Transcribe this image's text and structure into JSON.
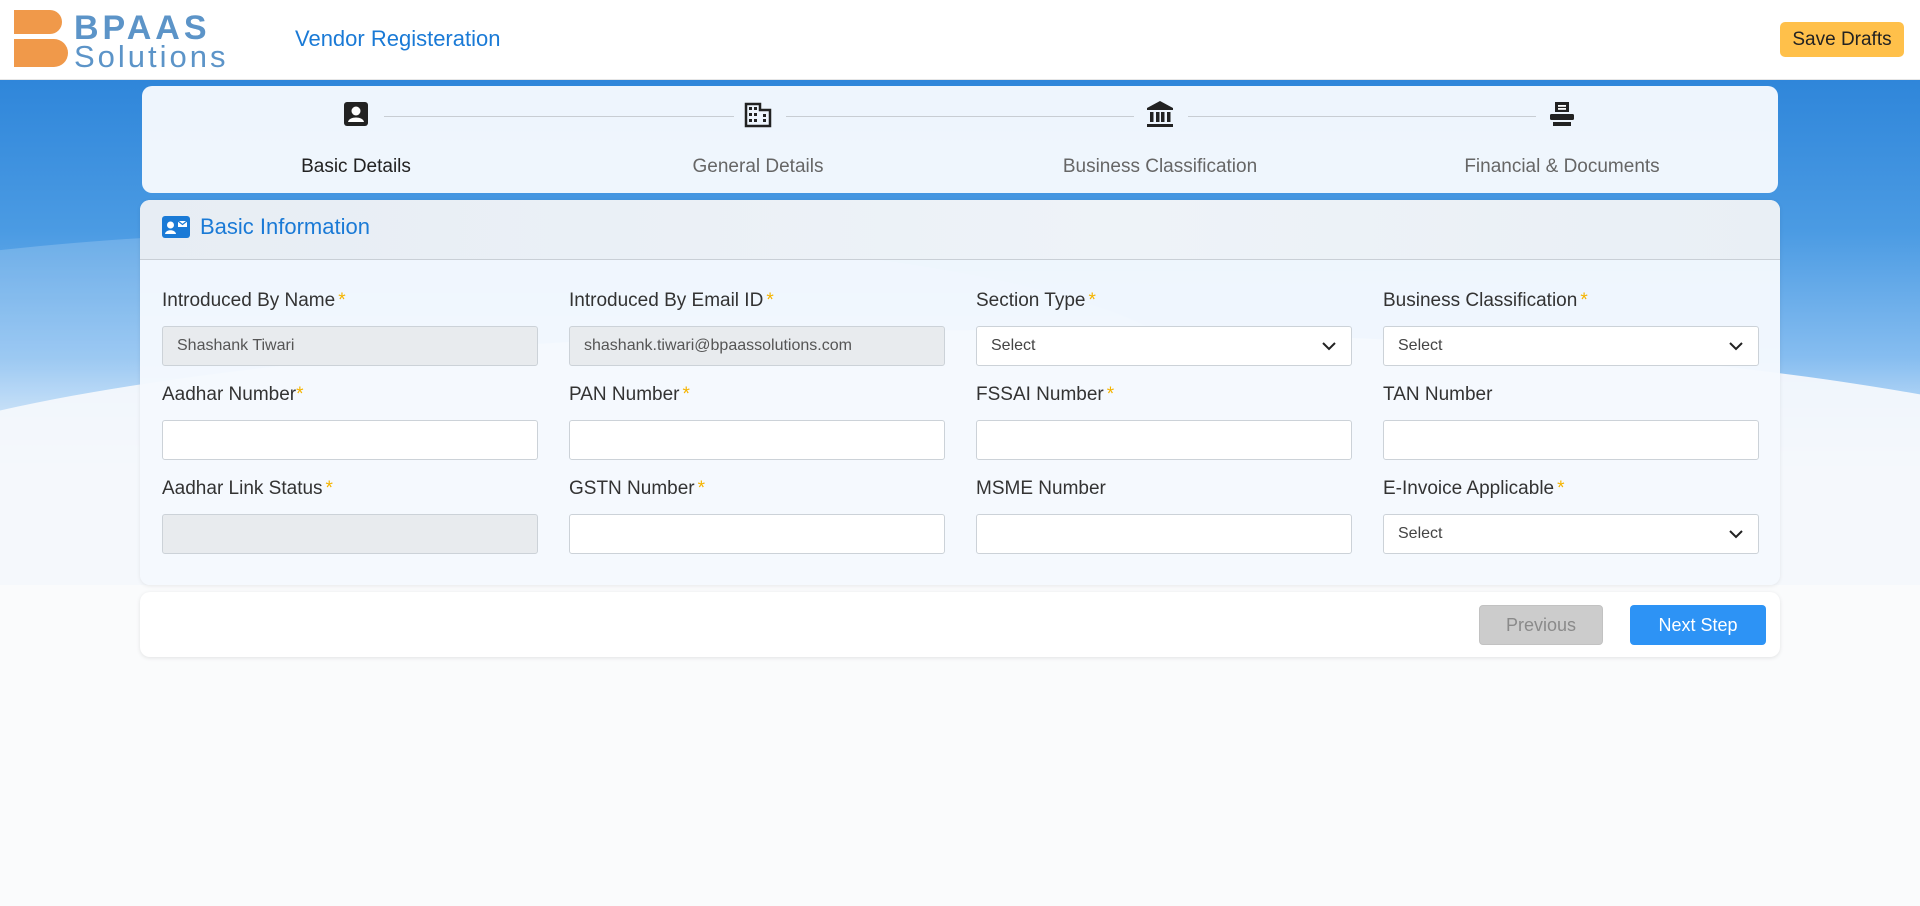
{
  "header": {
    "logo_line1": "BPAAS",
    "logo_line2": "Solutions",
    "title": "Vendor Registeration",
    "save_drafts_label": "Save Drafts"
  },
  "stepper": {
    "steps": [
      {
        "label": "Basic Details",
        "icon": "contact-icon",
        "active": true
      },
      {
        "label": "General Details",
        "icon": "building-icon",
        "active": false
      },
      {
        "label": "Business Classification",
        "icon": "bank-icon",
        "active": false
      },
      {
        "label": "Financial & Documents",
        "icon": "document-stamp-icon",
        "active": false
      }
    ]
  },
  "card": {
    "title": "Basic Information",
    "icon": "id-card-icon",
    "required_mark": "*",
    "fields": {
      "introduced_by_name": {
        "label": "Introduced By Name",
        "value": "Shashank Tiwari",
        "required": true
      },
      "introduced_by_email": {
        "label": "Introduced By Email ID",
        "value": "shashank.tiwari@bpaassolutions.com",
        "required": true
      },
      "section_type": {
        "label": "Section Type",
        "value": "Select",
        "required": true
      },
      "business_classification": {
        "label": "Business Classification",
        "value": "Select",
        "required": true
      },
      "aadhar_number": {
        "label": "Aadhar Number",
        "value": "",
        "required": true
      },
      "pan_number": {
        "label": "PAN Number",
        "value": "",
        "required": true
      },
      "fssai_number": {
        "label": "FSSAI Number",
        "value": "",
        "required": true
      },
      "tan_number": {
        "label": "TAN Number",
        "value": "",
        "required": false
      },
      "aadhar_link_status": {
        "label": "Aadhar Link Status",
        "value": "",
        "required": true
      },
      "gstn_number": {
        "label": "GSTN Number",
        "value": "",
        "required": true
      },
      "msme_number": {
        "label": "MSME Number",
        "value": "",
        "required": false
      },
      "e_invoice_applicable": {
        "label": "E-Invoice Applicable",
        "value": "Select",
        "required": true
      }
    }
  },
  "actions": {
    "previous_label": "Previous",
    "next_label": "Next Step"
  },
  "colors": {
    "brand_blue": "#1a7ad6",
    "logo_orange": "#f0994a",
    "accent_yellow": "#ffc04a",
    "primary_button": "#2d93f5"
  }
}
